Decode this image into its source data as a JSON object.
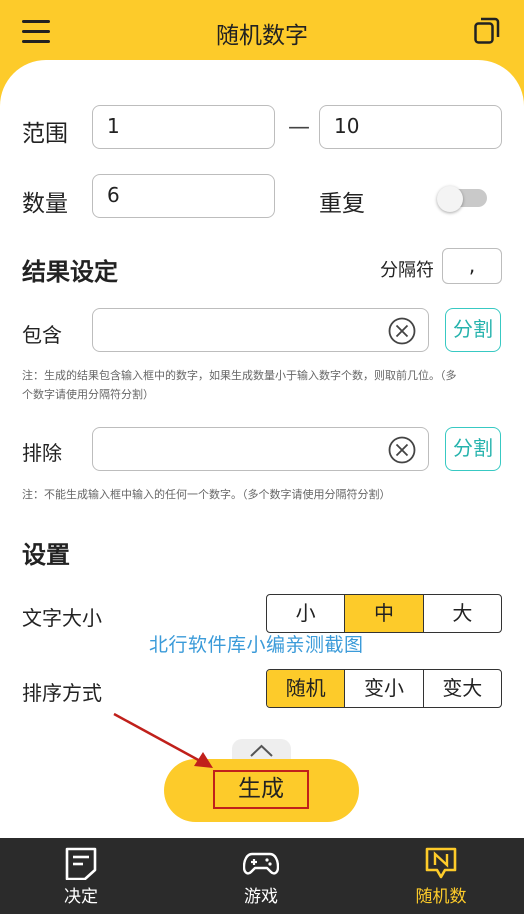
{
  "header": {
    "title": "随机数字",
    "menu_icon": "hamburger-menu-icon",
    "copy_icon": "copy-icon"
  },
  "range": {
    "label": "范围",
    "min": "1",
    "dash": "—",
    "max": "10"
  },
  "count": {
    "label": "数量",
    "value": "6",
    "repeat_label": "重复",
    "repeat_enabled": false
  },
  "result": {
    "title": "结果设定",
    "separator_label": "分隔符",
    "separator_value": ","
  },
  "include": {
    "label": "包含",
    "value": "",
    "split_label": "分割",
    "note_line1": "注：生成的结果包含输入框中的数字，如果生成数量小于输入数字个数，则取前几位。（多",
    "note_line2": "个数字请使用分隔符分割）"
  },
  "exclude": {
    "label": "排除",
    "value": "",
    "split_label": "分割",
    "note": "注：不能生成输入框中输入的任何一个数字。（多个数字请使用分隔符分割）"
  },
  "settings": {
    "title": "设置",
    "font_size": {
      "label": "文字大小",
      "options": [
        "小",
        "中",
        "大"
      ],
      "selected": "中"
    },
    "sort": {
      "label": "排序方式",
      "options": [
        "随机",
        "变小",
        "变大"
      ],
      "selected": "随机"
    }
  },
  "watermark": "北行软件库小编亲测截图",
  "generate": {
    "label": "生成"
  },
  "bottom_nav": [
    {
      "label": "决定",
      "icon": "decision-note-icon",
      "active": false
    },
    {
      "label": "游戏",
      "icon": "gamepad-icon",
      "active": false
    },
    {
      "label": "随机数",
      "icon": "random-number-icon",
      "active": true
    }
  ],
  "colors": {
    "accent": "#fdcb2a",
    "split_button": "#26b3ad",
    "nav_background": "#2b2b2b",
    "highlight_box": "#c0201b"
  }
}
